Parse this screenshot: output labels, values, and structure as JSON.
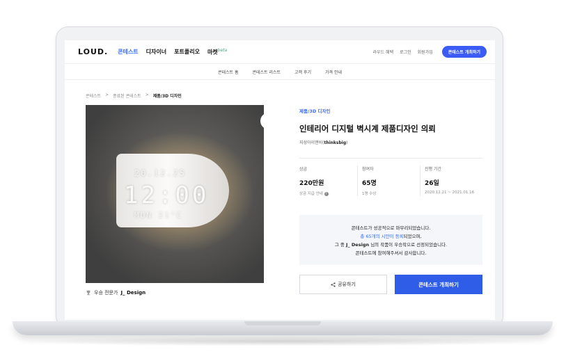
{
  "header": {
    "logo": "LOUD.",
    "nav": [
      {
        "label": "콘테스트",
        "active": true
      },
      {
        "label": "디자이너",
        "active": false
      },
      {
        "label": "포트폴리오",
        "active": false
      },
      {
        "label": "마켓",
        "active": false
      }
    ],
    "beta": "beta",
    "links": [
      "라우드 혜택",
      "로그인",
      "회원가입"
    ],
    "cta": "콘테스트 개최하기"
  },
  "subnav": [
    "콘테스트 홈",
    "콘테스트 리스트",
    "고객 후기",
    "가격 안내"
  ],
  "breadcrumb": [
    "콘테스트",
    "종료된 콘테스트",
    "제품/3D 디자인"
  ],
  "image": {
    "date": "20.12.25",
    "time": "12:00",
    "temp": "MON 21°C"
  },
  "winner": {
    "prefix": "우승 전문가",
    "name": "J_ Design"
  },
  "contest": {
    "category": "제품/3D 디자인",
    "title": "인테리어 디지털 벽시계 제품디자인 의뢰",
    "author_prefix": "지성아이앤비",
    "author_handle": "thinksbig"
  },
  "stats": [
    {
      "label": "상금",
      "value": "220만원",
      "sub": "상금 지급 안내"
    },
    {
      "label": "참여자",
      "value": "65명",
      "sub": "1명 수상"
    },
    {
      "label": "진행 기간",
      "value": "26일",
      "sub": "2020.12.21 ~ 2021.01.16"
    }
  ],
  "notice": {
    "line1": "콘테스트가 성공적으로 마무리되었습니다.",
    "line2_blue": "총 65개의 시안이 등록",
    "line2_rest": "되었으며,",
    "line3_pre": "그 중",
    "line3_name": "J_ Design",
    "line3_post": "님의 작품이 우승작으로 선정되었습니다.",
    "line4": "콘테스트에 참여해주셔서 감사합니다."
  },
  "buttons": {
    "share": "공유하기",
    "host": "콘테스트 개최하기"
  },
  "colors": {
    "accent": "#3b5bf5",
    "category": "#3b6ef5"
  }
}
